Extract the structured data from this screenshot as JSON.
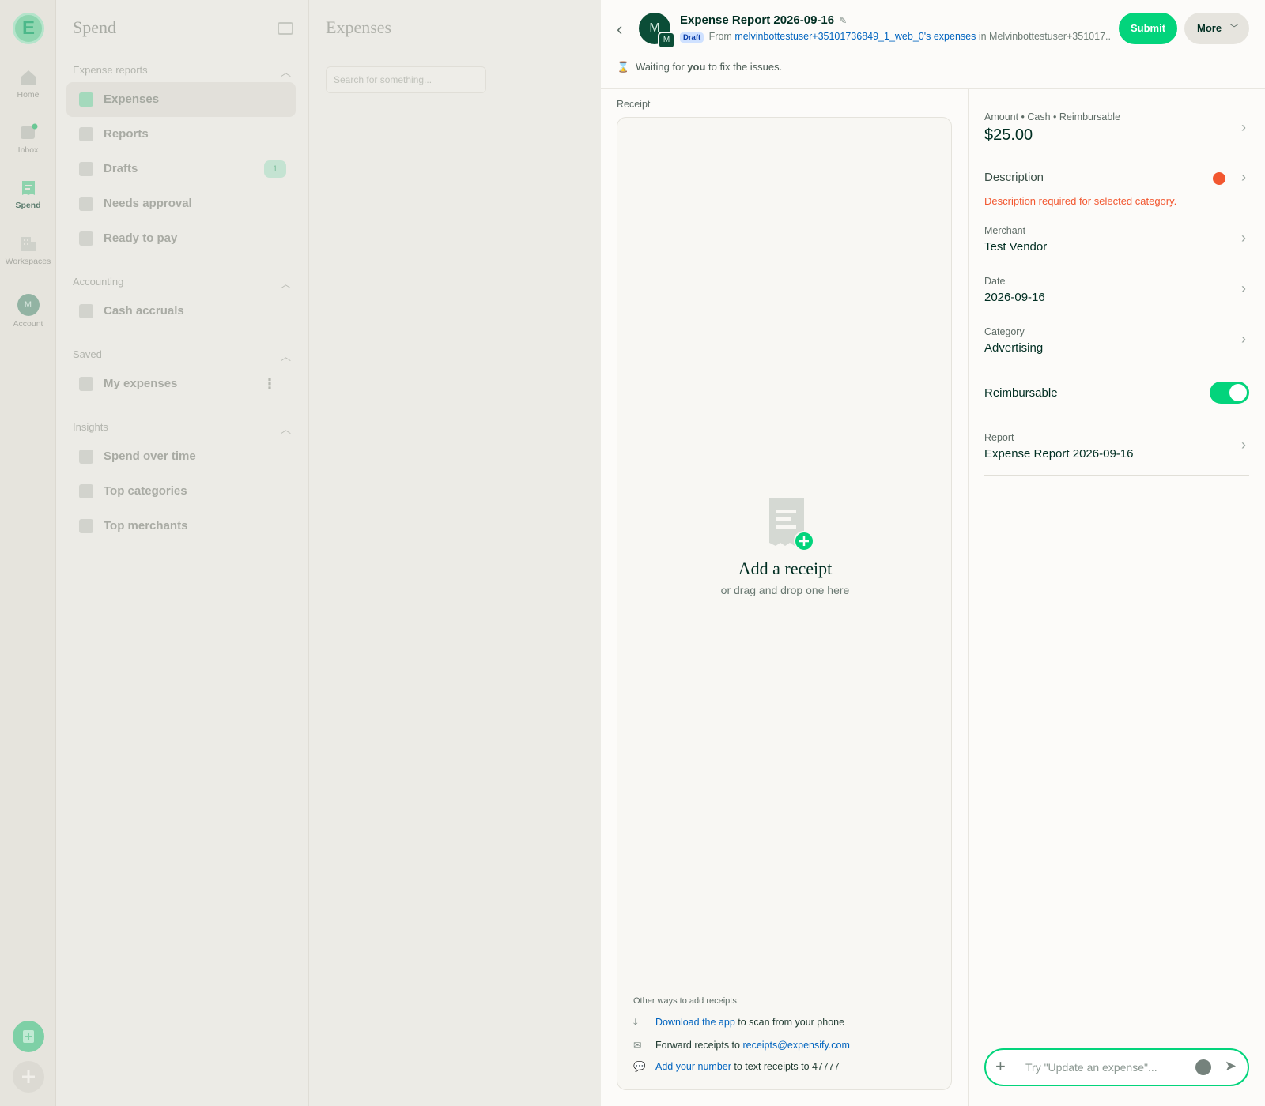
{
  "rail": {
    "logo_letter": "E",
    "items": [
      {
        "label": "Home"
      },
      {
        "label": "Inbox"
      },
      {
        "label": "Spend"
      },
      {
        "label": "Workspaces"
      },
      {
        "label": "Account",
        "avatar": "M"
      }
    ]
  },
  "sidebar": {
    "title": "Spend",
    "sections": {
      "expense_reports": "Expense reports",
      "accounting": "Accounting",
      "saved": "Saved",
      "insights": "Insights"
    },
    "items": {
      "expenses": "Expenses",
      "reports": "Reports",
      "drafts": "Drafts",
      "drafts_count": "1",
      "needs_approval": "Needs approval",
      "ready_to_pay": "Ready to pay",
      "cash_accruals": "Cash accruals",
      "my_expenses": "My expenses",
      "spend_over_time": "Spend over time",
      "top_categories": "Top categories",
      "top_merchants": "Top merchants"
    }
  },
  "list": {
    "title": "Expenses",
    "search_placeholder": "Search for something..."
  },
  "header": {
    "avatar": "M",
    "avatar_small": "M",
    "title": "Expense Report 2026-09-16",
    "draft_badge": "Draft",
    "from_prefix": "From",
    "from_link": "melvinbottestuser+35101736849_1_web_0's expenses",
    "in_text": "in Melvinbottestuser+351017...",
    "submit_label": "Submit",
    "more_label": "More",
    "status_prefix": "Waiting for",
    "status_bold": "you",
    "status_suffix": "to fix the issues."
  },
  "receipt": {
    "label": "Receipt",
    "add_title": "Add a receipt",
    "add_sub": "or drag and drop one here",
    "other_ways": "Other ways to add receipts:",
    "download_link": "Download the app",
    "download_rest": "to scan from your phone",
    "forward_prefix": "Forward receipts to",
    "forward_link": "receipts@expensify.com",
    "number_link": "Add your number",
    "number_rest": "to text receipts to 47777"
  },
  "details": {
    "amount_label": "Amount • Cash • Reimbursable",
    "amount_value": "$25.00",
    "description_label": "Description",
    "description_error": "Description required for selected category.",
    "merchant_label": "Merchant",
    "merchant_value": "Test Vendor",
    "date_label": "Date",
    "date_value": "2026-09-16",
    "category_label": "Category",
    "category_value": "Advertising",
    "reimbursable_label": "Reimbursable",
    "reimbursable_on": true,
    "report_label": "Report",
    "report_value": "Expense Report 2026-09-16"
  },
  "composer": {
    "placeholder": "Try \"Update an expense\"..."
  },
  "colors": {
    "accent": "#03d47c",
    "error": "#f25730",
    "link": "#0164bf",
    "dark_green": "#0b4d37"
  }
}
